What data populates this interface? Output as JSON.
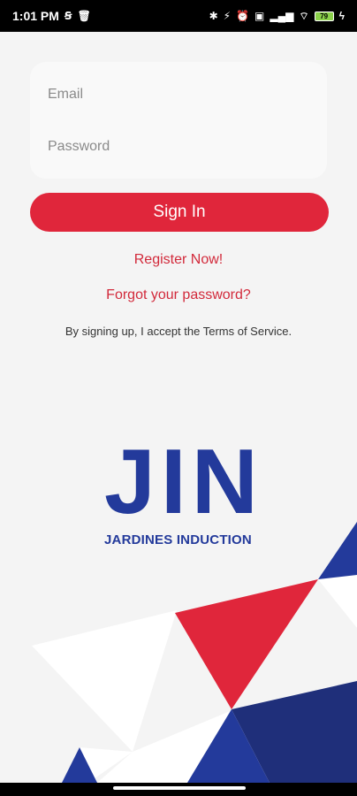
{
  "status_bar": {
    "time": "1:01 PM",
    "battery": "79"
  },
  "login": {
    "email_placeholder": "Email",
    "password_placeholder": "Password",
    "sign_in_label": "Sign In",
    "register_label": "Register Now!",
    "forgot_label": "Forgot your password?",
    "terms_text": "By signing up, I accept the Terms of Service."
  },
  "brand": {
    "logo_text": "JIN",
    "subtitle": "JARDINES INDUCTION",
    "colors": {
      "primary_red": "#e0263b",
      "brand_blue": "#233a9b",
      "dark_blue": "#1f2f7a"
    }
  }
}
